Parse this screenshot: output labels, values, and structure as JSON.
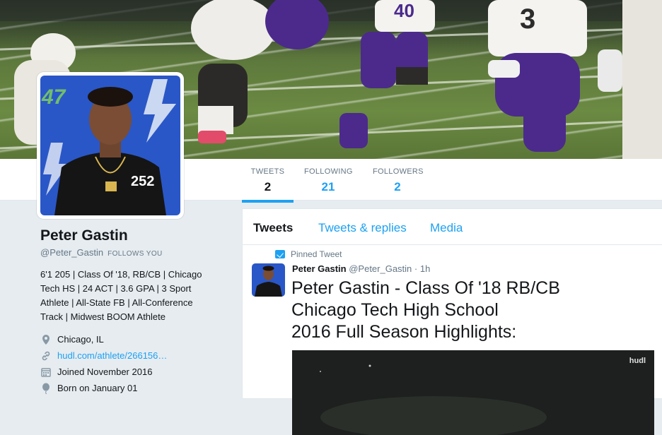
{
  "profile": {
    "name": "Peter Gastin",
    "handle": "@Peter_Gastin",
    "follows_you": "FOLLOWS YOU",
    "bio_lines": [
      "6'1 205 | Class Of '18, RB/CB | Chicago",
      "Tech HS | 24 ACT | 3.6 GPA | 3 Sport",
      "Athlete | All-State FB | All-Conference",
      "Track | Midwest BOOM Athlete"
    ],
    "location": "Chicago, IL",
    "website": "hudl.com/athlete/266156…",
    "joined": "Joined November 2016",
    "born": "Born on January 01"
  },
  "avatar": {
    "jersey_number": "252",
    "logo_text": "47"
  },
  "stats": [
    {
      "label": "TWEETS",
      "value": "2"
    },
    {
      "label": "FOLLOWING",
      "value": "21"
    },
    {
      "label": "FOLLOWERS",
      "value": "2"
    }
  ],
  "tabs": {
    "tweets": "Tweets",
    "replies": "Tweets & replies",
    "media": "Media"
  },
  "tweet": {
    "pinned_label": "Pinned Tweet",
    "author": "Peter Gastin",
    "handle": "@Peter_Gastin",
    "time": "· 1h",
    "lines": [
      "Peter Gastin - Class Of '18 RB/CB",
      "Chicago Tech High School",
      "2016 Full Season Highlights:"
    ],
    "video_watermark": "hudl"
  },
  "banner": {
    "jersey_numbers": [
      "40",
      "3"
    ]
  },
  "colors": {
    "accent": "#1da1f2",
    "background": "#e6ecf0",
    "avatar_bg": "#2a57c7",
    "jersey_purple": "#4b2a8c"
  }
}
